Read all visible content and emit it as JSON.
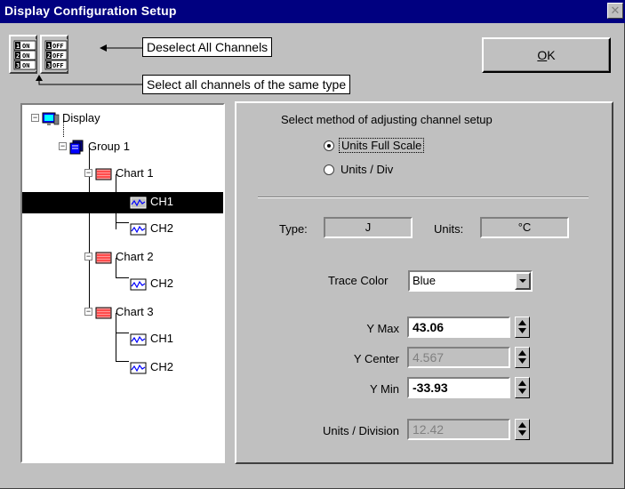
{
  "window": {
    "title": "Display Configuration  Setup",
    "close_glyph": "✕"
  },
  "toolbar": {
    "on_button": {
      "rows": [
        {
          "num": "1",
          "state": "ON"
        },
        {
          "num": "2",
          "state": "ON"
        },
        {
          "num": "3",
          "state": "ON"
        }
      ]
    },
    "off_button": {
      "rows": [
        {
          "num": "1",
          "state": "OFF"
        },
        {
          "num": "2",
          "state": "OFF"
        },
        {
          "num": "3",
          "state": "OFF"
        }
      ]
    },
    "callout_deselect": "Deselect All Channels",
    "callout_select_type": "Select all channels of the same type",
    "ok_label_prefix": "O",
    "ok_label_rest": "K"
  },
  "tree": {
    "root": "Display",
    "group": "Group 1",
    "chart1": "Chart 1",
    "chart1_ch1": "CH1",
    "chart1_ch2": "CH2",
    "chart2": "Chart 2",
    "chart2_ch2": "CH2",
    "chart3": "Chart 3",
    "chart3_ch1": "CH1",
    "chart3_ch2": "CH2",
    "expander_glyph": "−",
    "selected": "chart1_ch1"
  },
  "panel": {
    "method_heading": "Select method of adjusting channel setup",
    "method_options": [
      "Units Full Scale",
      "Units / Div"
    ],
    "method_selected": "Units Full Scale",
    "type_label": "Type:",
    "type_value": "J",
    "units_label": "Units:",
    "units_value": "°C",
    "trace_color_label": "Trace Color",
    "trace_color_value": "Blue",
    "ymax_label": "Y Max",
    "ymax_value": "43.06",
    "ycenter_label": "Y Center",
    "ycenter_value": "4.567",
    "ymin_label": "Y Min",
    "ymin_value": "-33.93",
    "units_div_label": "Units / Division",
    "units_div_value": "12.42"
  },
  "colors": {
    "titlebar": "#000080",
    "face": "#c0c0c0",
    "chart_icon": "#ff0000",
    "display_icon": "#0000ff"
  }
}
